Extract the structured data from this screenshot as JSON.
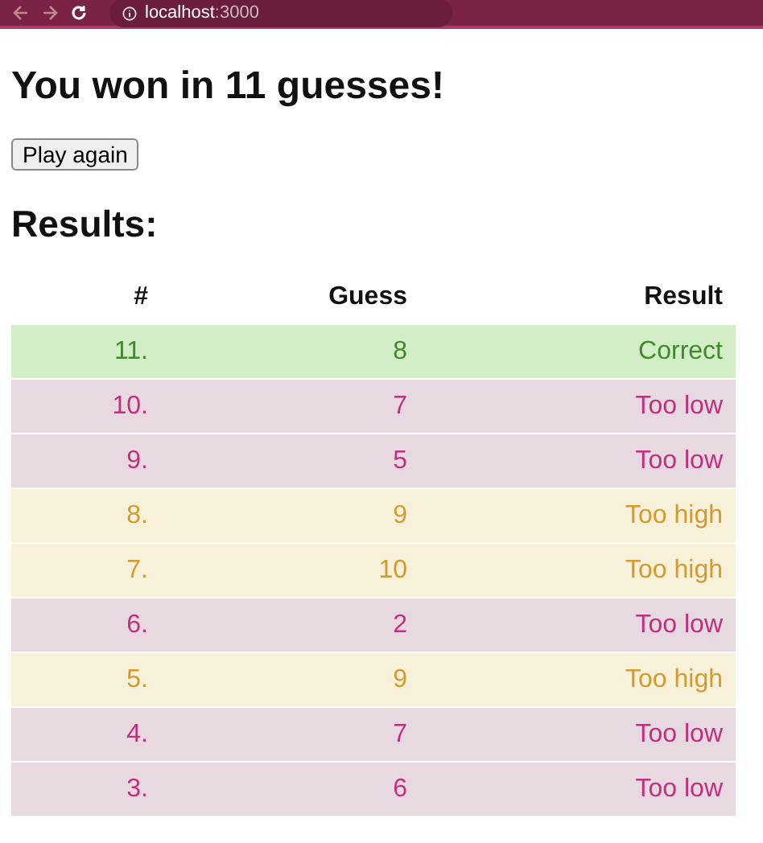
{
  "browser": {
    "url": "**localhost**:3000"
  },
  "heading": "You won in 11 guesses!",
  "play_button": "Play again",
  "results_heading": "Results:",
  "table": {
    "columns": [
      "#",
      "Guess",
      "Result"
    ],
    "rows": [
      {
        "kind": "correct",
        "number": "11.",
        "guess": "8",
        "result": "Correct"
      },
      {
        "kind": "low",
        "number": "10.",
        "guess": "7",
        "result": "Too low"
      },
      {
        "kind": "low",
        "number": "9.",
        "guess": "5",
        "result": "Too low"
      },
      {
        "kind": "high",
        "number": "8.",
        "guess": "9",
        "result": "Too high"
      },
      {
        "kind": "high",
        "number": "7.",
        "guess": "10",
        "result": "Too high"
      },
      {
        "kind": "low",
        "number": "6.",
        "guess": "2",
        "result": "Too low"
      },
      {
        "kind": "high",
        "number": "5.",
        "guess": "9",
        "result": "Too high"
      },
      {
        "kind": "low",
        "number": "4.",
        "guess": "7",
        "result": "Too low"
      },
      {
        "kind": "low",
        "number": "3.",
        "guess": "6",
        "result": "Too low"
      }
    ]
  }
}
